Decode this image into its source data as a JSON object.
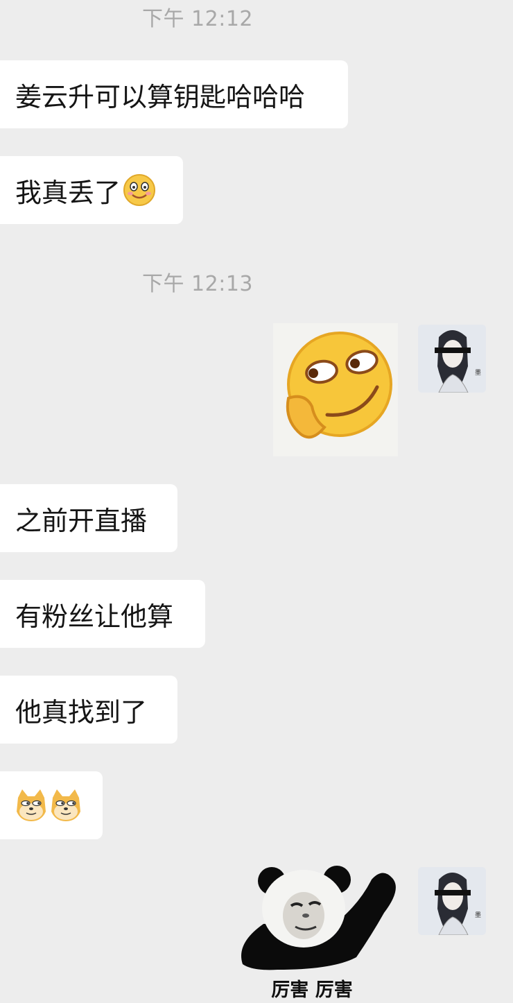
{
  "chat": {
    "timestamps": [
      "下午 12:12",
      "下午 12:13"
    ],
    "messages": [
      {
        "text": "姜云升可以算钥匙哈哈哈"
      },
      {
        "text": "我真丢了"
      },
      {
        "text": "之前开直播"
      },
      {
        "text": "有粉丝让他算"
      },
      {
        "text": "他真找到了"
      }
    ],
    "stickers": {
      "panda_caption": "厉害 厉害"
    },
    "icons": {
      "grin_emoji": "awkward-grin-emoji",
      "doge_emoji": "doge-emoji"
    }
  },
  "colors": {
    "background": "#ededed",
    "bubble": "#ffffff",
    "timestamp": "#a8a8a8"
  }
}
